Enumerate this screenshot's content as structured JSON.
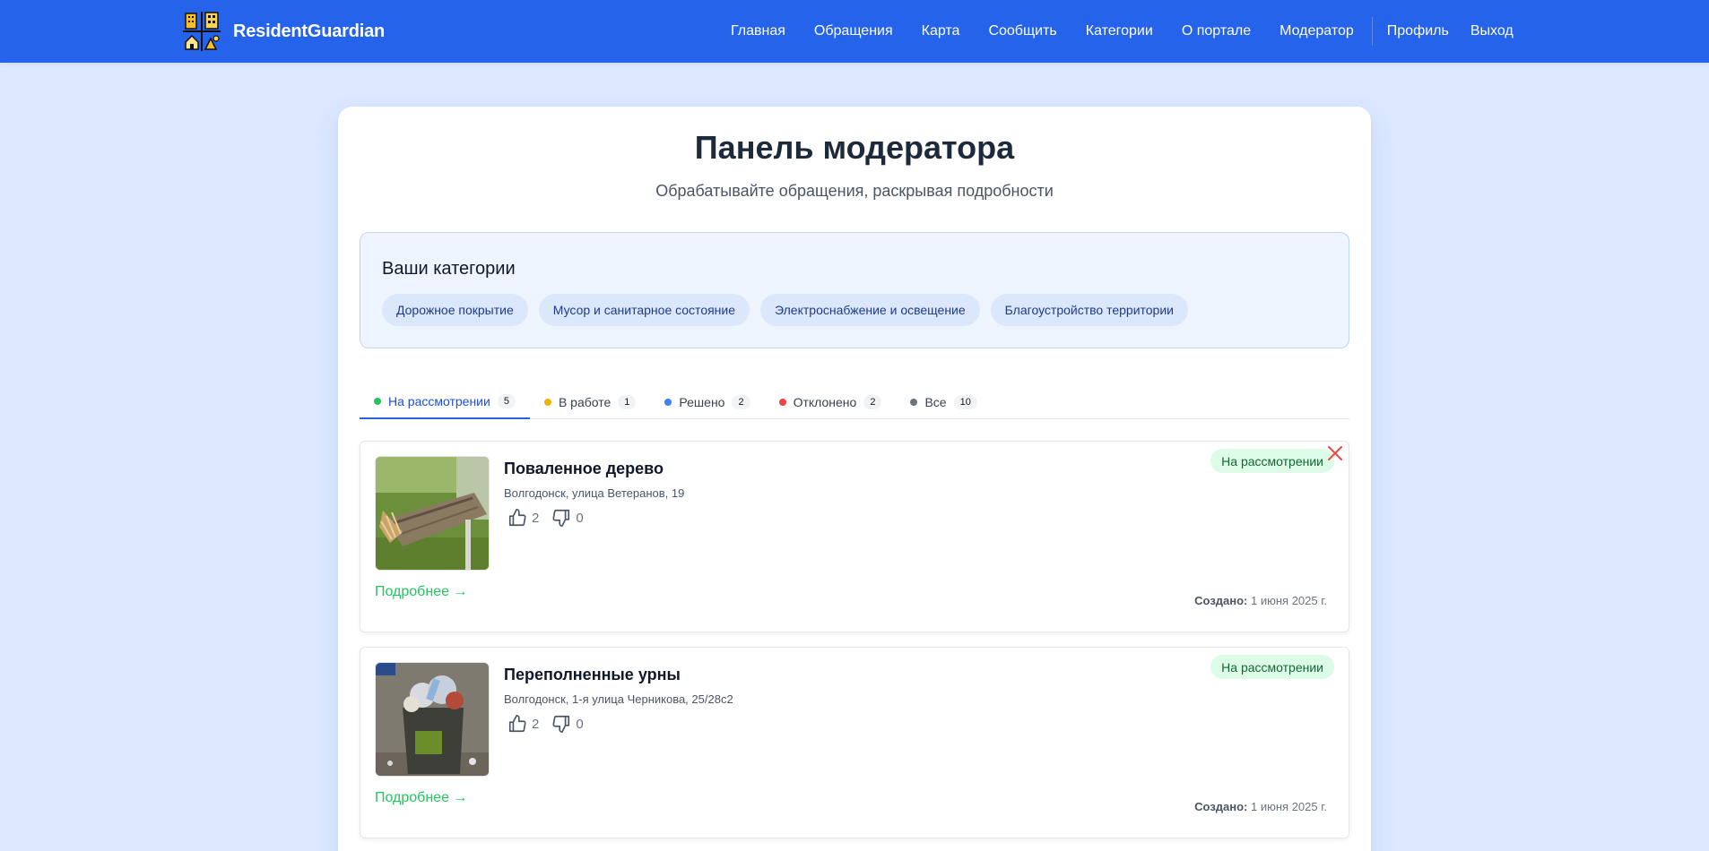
{
  "header": {
    "brand": "ResidentGuardian",
    "nav": [
      "Главная",
      "Обращения",
      "Карта",
      "Сообщить",
      "Категории",
      "О портале",
      "Модератор"
    ],
    "nav_right": [
      "Профиль",
      "Выход"
    ]
  },
  "page": {
    "title": "Панель модератора",
    "subtitle": "Обрабатывайте обращения, раскрывая подробности"
  },
  "categories": {
    "title": "Ваши категории",
    "items": [
      "Дорожное покрытие",
      "Мусор и санитарное состояние",
      "Электроснабжение и освещение",
      "Благоустройство территории"
    ]
  },
  "tabs": [
    {
      "label": "На рассмотрении",
      "count": "5",
      "color": "#22c55e",
      "active": true
    },
    {
      "label": "В работе",
      "count": "1",
      "color": "#eab308",
      "active": false
    },
    {
      "label": "Решено",
      "count": "2",
      "color": "#3b82f6",
      "active": false
    },
    {
      "label": "Отклонено",
      "count": "2",
      "color": "#ef4444",
      "active": false
    },
    {
      "label": "Все",
      "count": "10",
      "color": "#6b7280",
      "active": false
    }
  ],
  "reports": [
    {
      "title": "Поваленное дерево",
      "address": "Волгодонск, улица Ветеранов, 19",
      "likes": "2",
      "dislikes": "0",
      "status": "На рассмотрении",
      "more": "Подробнее →",
      "created_label": "Создано:",
      "created_date": "1 июня 2025 г."
    },
    {
      "title": "Переполненные урны",
      "address": "Волгодонск, 1-я улица Черникова, 25/28с2",
      "likes": "2",
      "dislikes": "0",
      "status": "На рассмотрении",
      "more": "Подробнее →",
      "created_label": "Создано:",
      "created_date": "1 июня 2025 г."
    }
  ],
  "colors": {
    "header": "#2563eb",
    "background": "#dbe8fe",
    "accent_green": "#22c55e",
    "status_bg": "#dcfce7",
    "close": "#ef4444"
  },
  "icons": [
    "city-logo-icon",
    "thumbs-up-icon",
    "thumbs-down-icon",
    "close-icon"
  ]
}
